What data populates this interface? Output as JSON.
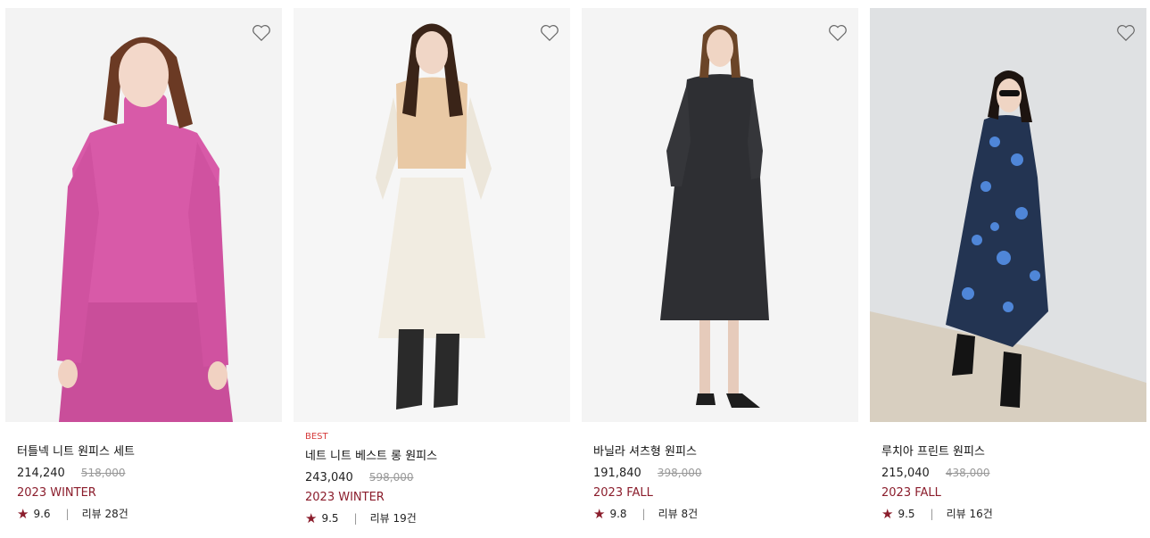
{
  "products": [
    {
      "badge": "",
      "name": "터틀넥 니트 원피스 세트",
      "price": "214,240",
      "original_price": "518,000",
      "season": "2023 WINTER",
      "rating": "9.6",
      "reviews": "리뷰 28건",
      "image": "model-pink-turtleneck-knit-dress"
    },
    {
      "badge": "BEST",
      "name": "네트 니트 베스트 롱 원피스",
      "price": "243,040",
      "original_price": "598,000",
      "season": "2023 WINTER",
      "rating": "9.5",
      "reviews": "리뷰 19건",
      "image": "model-cream-knit-vest-long-dress"
    },
    {
      "badge": "",
      "name": "바닐라 셔츠형 원피스",
      "price": "191,840",
      "original_price": "398,000",
      "season": "2023 FALL",
      "rating": "9.8",
      "reviews": "리뷰 8건",
      "image": "model-black-shirt-dress"
    },
    {
      "badge": "",
      "name": "루치아 프린트 원피스",
      "price": "215,040",
      "original_price": "438,000",
      "season": "2023 FALL",
      "rating": "9.5",
      "reviews": "리뷰 16건",
      "image": "model-blue-floral-print-dress"
    }
  ],
  "colors": {
    "accent": "#8b1d2c",
    "badge": "#d63b3b",
    "muted": "#999999"
  },
  "icons": {
    "wishlist": "heart-outline-icon",
    "rating": "star-icon"
  }
}
